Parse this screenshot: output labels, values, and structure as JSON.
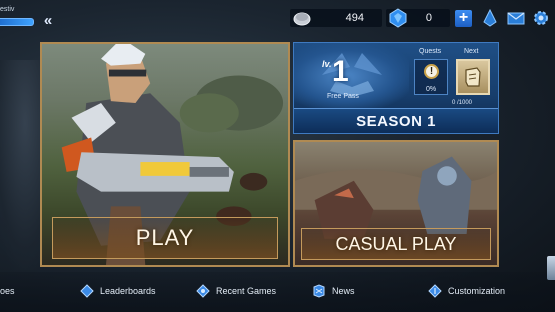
{
  "header": {
    "player_name": "estiv",
    "collapse_label": "«",
    "battle_points": "494",
    "diamonds": "0",
    "add_label": "+"
  },
  "play": {
    "label": "PLAY"
  },
  "season": {
    "level_prefix": "lv.",
    "level": "1",
    "pass_label": "Free Pass",
    "quests_label": "Quests",
    "quest_progress": "0%",
    "quest_alert": "!",
    "next_label": "Next",
    "exp_progress": "0 /1000",
    "title": "SEASON 1"
  },
  "casual": {
    "label": "CASUAL PLAY"
  },
  "nav": {
    "items": [
      {
        "label": "oes",
        "icon": "partial-icon"
      },
      {
        "label": "Leaderboards",
        "icon": "leaderboard-icon"
      },
      {
        "label": "Recent Games",
        "icon": "recent-games-icon"
      },
      {
        "label": "News",
        "icon": "news-icon"
      },
      {
        "label": "Customization",
        "icon": "customization-icon"
      }
    ]
  },
  "colors": {
    "accent_blue": "#3d8ef2",
    "gold_border": "#b08a52",
    "season_blue": "#1f4f86"
  }
}
